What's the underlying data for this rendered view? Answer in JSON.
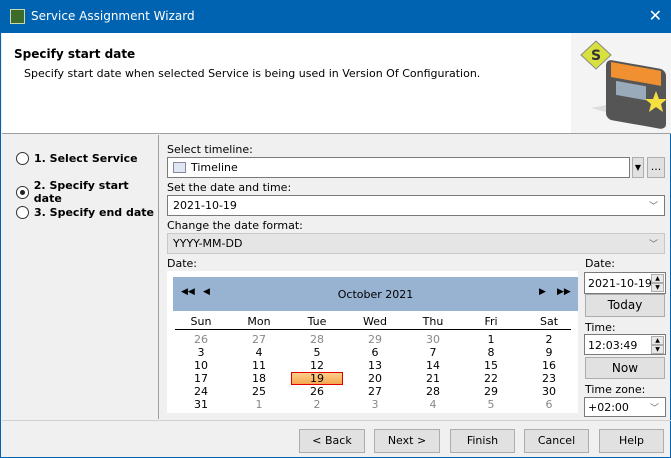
{
  "window": {
    "title": "Service Assignment Wizard",
    "close": "✕"
  },
  "header": {
    "title": "Specify start date",
    "description": "Specify start date when selected Service is being used in Version Of Configuration."
  },
  "steps": [
    {
      "label": "1. Select Service",
      "selected": false
    },
    {
      "label": "2. Specify start date",
      "selected": true
    },
    {
      "label": "3. Specify end date",
      "selected": false
    }
  ],
  "form": {
    "timeline_label": "Select timeline:",
    "timeline_value": "Timeline",
    "more_label": "...",
    "datetime_label": "Set the date and time:",
    "datetime_value": "2021-10-19",
    "format_label": "Change the date format:",
    "format_value": "YYYY-MM-DD",
    "date_label": "Date:"
  },
  "calendar": {
    "month": "October  2021",
    "weekdays": [
      "Sun",
      "Mon",
      "Tue",
      "Wed",
      "Thu",
      "Fri",
      "Sat"
    ],
    "weeks": [
      [
        "26",
        "27",
        "28",
        "29",
        "30",
        "1",
        "2"
      ],
      [
        "3",
        "4",
        "5",
        "6",
        "7",
        "8",
        "9"
      ],
      [
        "10",
        "11",
        "12",
        "13",
        "14",
        "15",
        "16"
      ],
      [
        "17",
        "18",
        "19",
        "20",
        "21",
        "22",
        "23"
      ],
      [
        "24",
        "25",
        "26",
        "27",
        "28",
        "29",
        "30"
      ],
      [
        "31",
        "1",
        "2",
        "3",
        "4",
        "5",
        "6"
      ]
    ],
    "selected": "19",
    "header_color": "#98b3d1"
  },
  "side": {
    "date_label": "Date:",
    "date_value": "2021-10-19",
    "today": "Today",
    "time_label": "Time:",
    "time_value": "12:03:49",
    "now": "Now",
    "tz_label": "Time zone:",
    "tz_value": "+02:00"
  },
  "buttons": {
    "back": "< Back",
    "next": "Next >",
    "finish": "Finish",
    "cancel": "Cancel",
    "help": "Help"
  }
}
